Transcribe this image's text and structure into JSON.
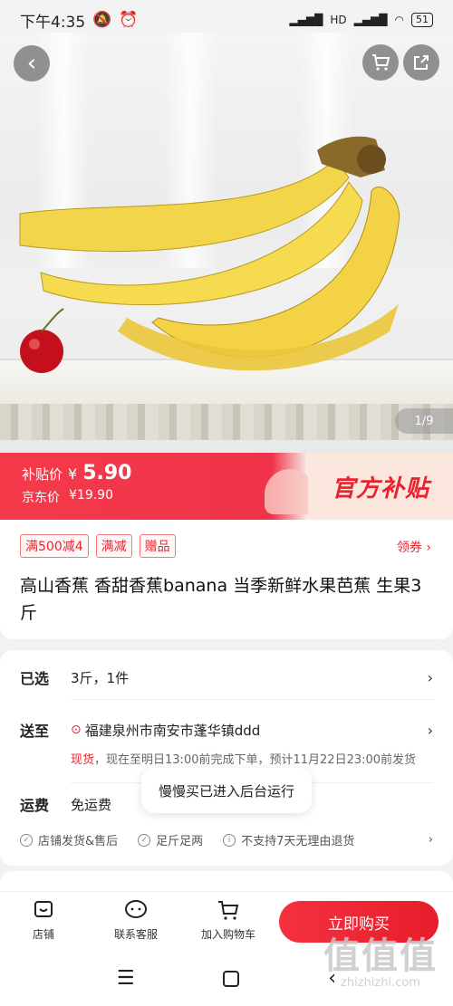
{
  "status_bar": {
    "time": "下午4:35",
    "network": "HD",
    "battery": "51"
  },
  "gallery": {
    "counter": "1/9"
  },
  "price": {
    "subsidy_label": "补贴价",
    "currency": "¥",
    "subsidy_value": "5.90",
    "jd_label": "京东价",
    "jd_value": "¥19.90",
    "badge": "官方补贴"
  },
  "promo_tags": [
    "满500减4",
    "满减",
    "赠品"
  ],
  "coupon_link": "领券 ›",
  "product_title": "高山香蕉 香甜香蕉banana 当季新鲜水果芭蕉 生果3斤",
  "selected": {
    "label": "已选",
    "value": "3斤，1件"
  },
  "delivery": {
    "label": "送至",
    "address": "福建泉州市南安市蓬华镇ddd",
    "stock": "现货",
    "note": "，现在至明日13:00前完成下单，预计11月22日23:00前发货"
  },
  "shipping": {
    "label": "运费",
    "value": "免运费"
  },
  "guarantees": [
    "店铺发货&售后",
    "足斤足两",
    "不支持7天无理由退货"
  ],
  "toast": "慢慢买已进入后台运行",
  "actions": {
    "shop": "店铺",
    "service": "联系客服",
    "cart": "加入购物车",
    "buy": "立即购买"
  },
  "watermark": {
    "main": "值值值",
    "sub": "zhizhizhi.com"
  },
  "colors": {
    "accent": "#e8232e",
    "banner": "#f43a4a"
  }
}
